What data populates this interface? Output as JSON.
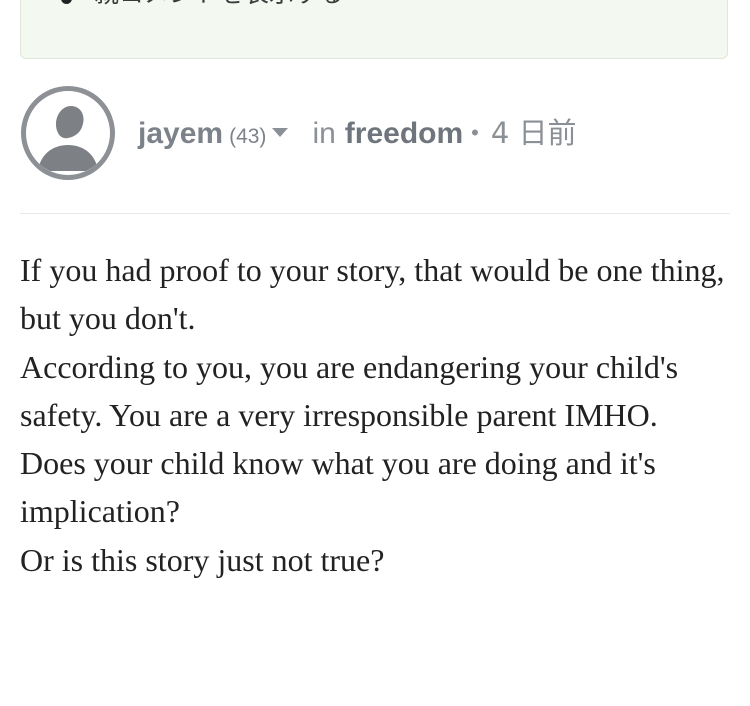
{
  "parent_comment_box": {
    "link_label": "親コメントを表示する"
  },
  "post_meta": {
    "author": "jayem",
    "reputation": "(43)",
    "in_label": "in",
    "community": "freedom",
    "separator": "•",
    "time_ago": "4 日前"
  },
  "comment": {
    "paragraphs": [
      "If you had proof to your story, that would be one thing, but you don't.",
      "According to you, you are endangering your child's safety. You are a very irresponsible parent IMHO.",
      "Does your child know what you are doing and it's implication?",
      "Or is this story just not true?"
    ]
  },
  "colors": {
    "parent_box_bg": "#f3f9f1",
    "meta_text": "#8b9096",
    "body_text": "#222222"
  },
  "icons": {
    "avatar": "default-user-avatar-icon",
    "dropdown": "caret-down-icon",
    "bullet": "bullet-dot-icon"
  }
}
